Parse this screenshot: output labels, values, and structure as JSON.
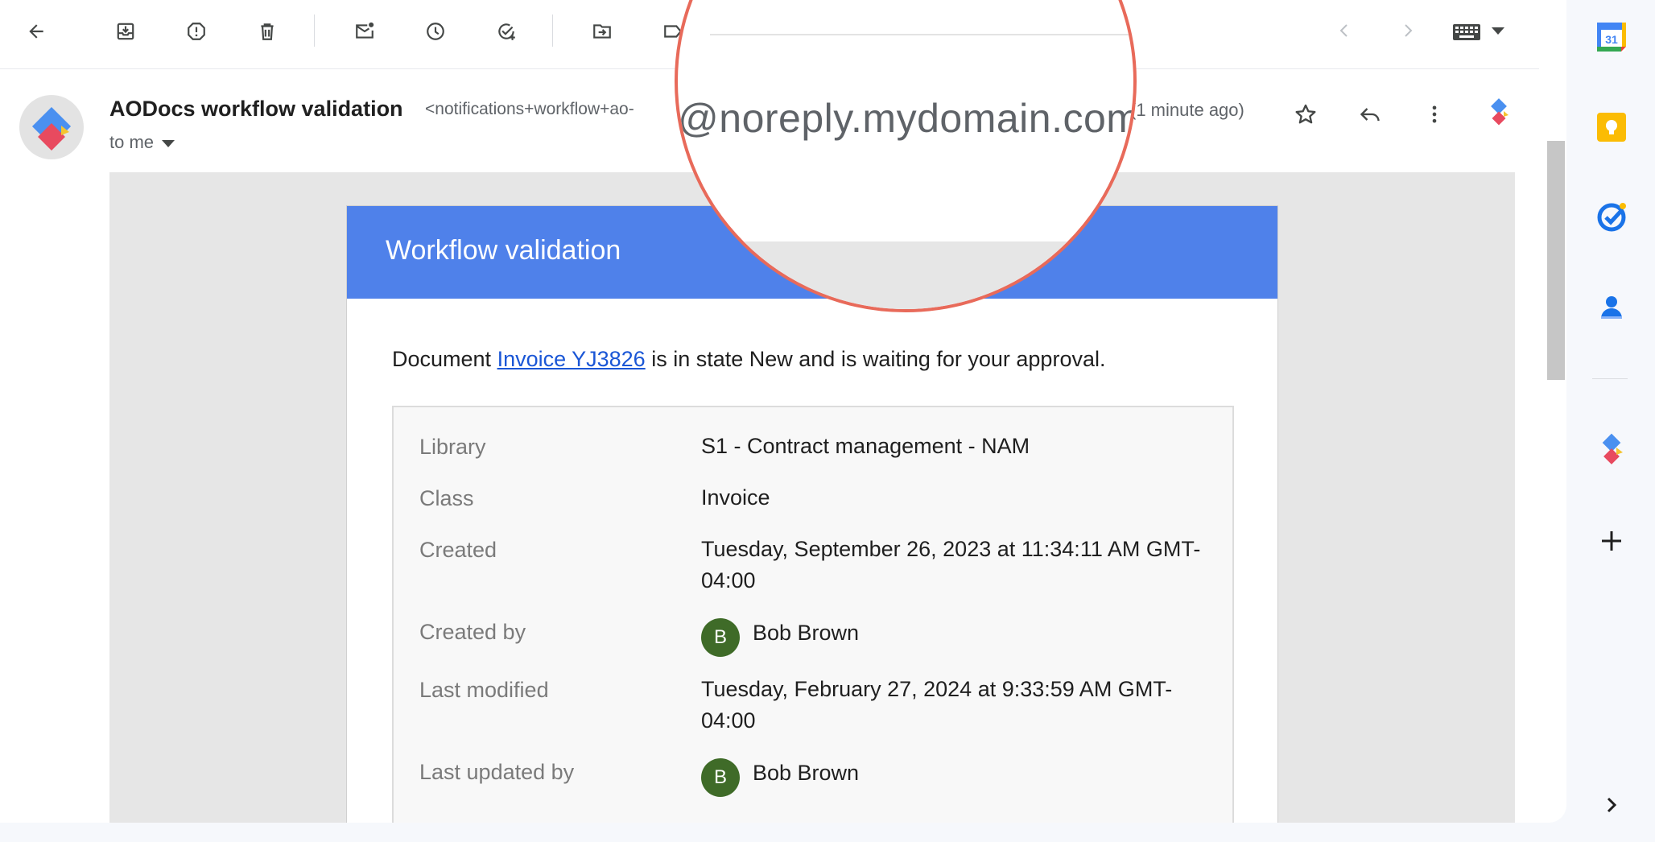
{
  "email": {
    "sender_name": "AODocs workflow validation",
    "sender_email": "<notifications+workflow+ao-",
    "to_label": "to me",
    "timestamp": "(1 minute ago)"
  },
  "magnifier": {
    "text": "@noreply.mydomain.com>"
  },
  "message": {
    "title": "Workflow validation",
    "intro_before": "Document ",
    "document_link": "Invoice YJ3826",
    "intro_after": " is in state New and is waiting for your approval.",
    "properties": [
      {
        "label": "Library",
        "value": "S1 - Contract management - NAM"
      },
      {
        "label": "Class",
        "value": "Invoice"
      },
      {
        "label": "Created",
        "value": "Tuesday, September 26, 2023 at 11:34:11 AM GMT-04:00"
      },
      {
        "label": "Created by",
        "initial": "B",
        "value": "Bob Brown"
      },
      {
        "label": "Last modified",
        "value": "Tuesday, February 27, 2024 at 9:33:59 AM GMT-04:00"
      },
      {
        "label": "Last updated by",
        "initial": "B",
        "value": "Bob Brown"
      }
    ]
  },
  "side_panel": {
    "calendar_day": "31"
  },
  "icons": {
    "toolbar": [
      "back-arrow-icon",
      "archive-icon",
      "report-spam-icon",
      "delete-icon",
      "mark-unread-icon",
      "snooze-icon",
      "add-to-tasks-icon",
      "move-to-icon",
      "label-icon"
    ],
    "nav": [
      "newer-chevron-icon",
      "older-chevron-icon",
      "keyboard-icon"
    ],
    "header": [
      "star-icon",
      "reply-icon",
      "more-vert-icon",
      "aodocs-logo-icon"
    ],
    "side": [
      "calendar-icon",
      "keep-icon",
      "tasks-icon",
      "contacts-icon",
      "aodocs-addon-icon",
      "add-addon-icon",
      "expand-panel-icon"
    ]
  },
  "colors": {
    "accent_blue": "#4f81ea",
    "magnifier_ring": "#e86a5a",
    "avatar_green": "#3f6b28",
    "link": "#1a56d6"
  }
}
